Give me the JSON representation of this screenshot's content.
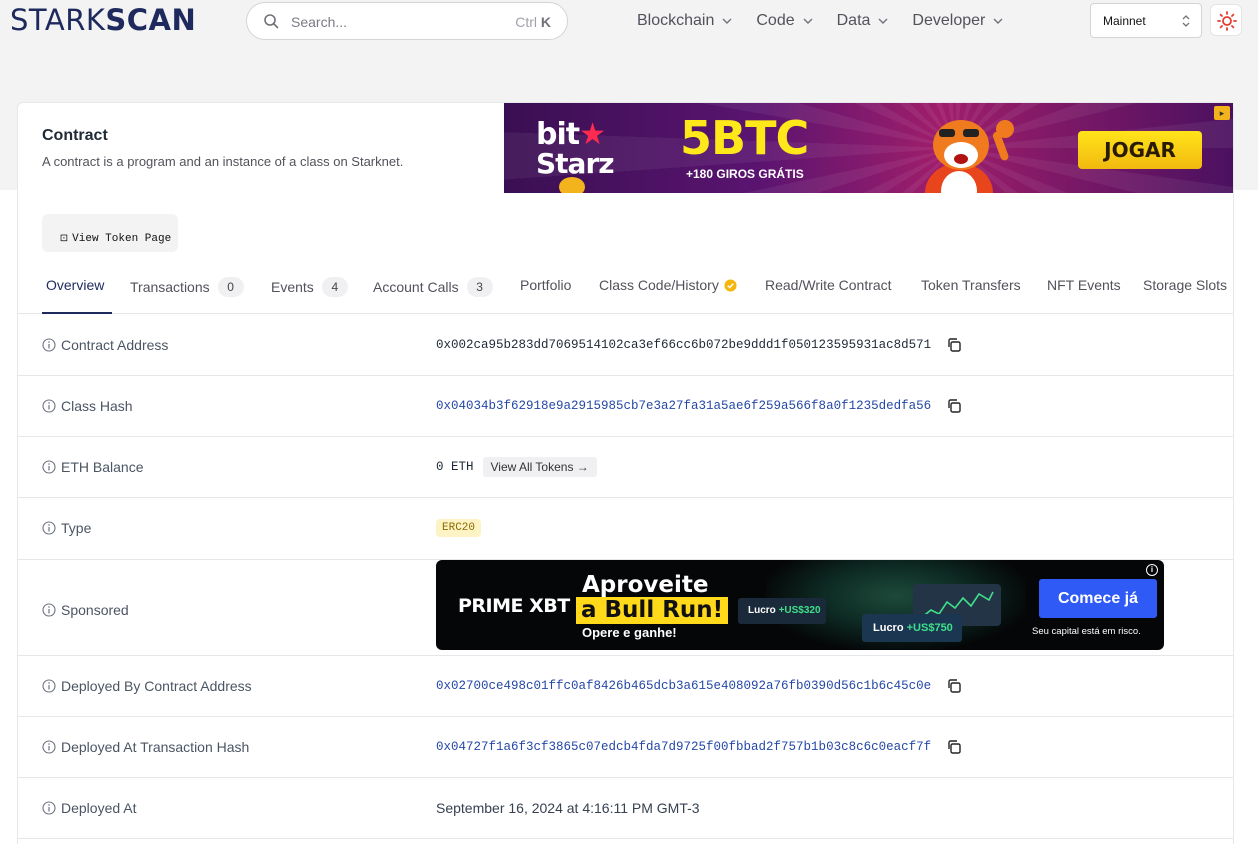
{
  "header": {
    "logo_light": "STARK",
    "logo_bold": "SCAN",
    "search_placeholder": "Search...",
    "search_shortcut_ctrl": "Ctrl",
    "search_shortcut_key": "K",
    "nav": [
      "Blockchain",
      "Code",
      "Data",
      "Developer"
    ],
    "network": "Mainnet"
  },
  "page": {
    "title": "Contract",
    "subtitle": "A contract is a program and an instance of a class on Starknet.",
    "token_button": "View Token Page"
  },
  "top_ad": {
    "brand_line1_a": "bit",
    "brand_line2": "Starz",
    "headline": "5BTC",
    "sub": "+180 GIROS GRÁTIS",
    "cta": "JOGAR"
  },
  "tabs": [
    {
      "label": "Overview",
      "count": null,
      "active": true
    },
    {
      "label": "Transactions",
      "count": "0"
    },
    {
      "label": "Events",
      "count": "4"
    },
    {
      "label": "Account Calls",
      "count": "3"
    },
    {
      "label": "Portfolio",
      "count": null
    },
    {
      "label": "Class Code/History",
      "count": null,
      "verified": true
    },
    {
      "label": "Read/Write Contract",
      "count": null
    },
    {
      "label": "Token Transfers",
      "count": null
    },
    {
      "label": "NFT Events",
      "count": null
    },
    {
      "label": "Storage Slots",
      "count": null
    }
  ],
  "details": {
    "contract_address": {
      "label": "Contract Address",
      "value": "0x002ca95b283dd7069514102ca3ef66cc6b072be9ddd1f050123595931ac8d571"
    },
    "class_hash": {
      "label": "Class Hash",
      "value": "0x04034b3f62918e9a2915985cb7e3a27fa31a5ae6f259a566f8a0f1235dedfa56"
    },
    "eth_balance": {
      "label": "ETH Balance",
      "value": "0 ETH",
      "action": "View All Tokens →"
    },
    "type": {
      "label": "Type",
      "value": "ERC20"
    },
    "sponsored": {
      "label": "Sponsored"
    },
    "deployed_by": {
      "label": "Deployed By Contract Address",
      "value": "0x02700ce498c01ffc0af8426b465dcb3a615e408092a76fb0390d56c1b6c45c0e"
    },
    "deployed_tx": {
      "label": "Deployed At Transaction Hash",
      "value": "0x04727f1a6f3cf3865c07edcb4fda7d9725f00fbbad2f757b1b03c8c6c0eacf7f"
    },
    "deployed_at": {
      "label": "Deployed At",
      "value": "September 16, 2024 at 4:16:11 PM GMT-3"
    }
  },
  "mid_ad": {
    "brand": "PRIME XBT",
    "line1": "Aproveite",
    "line2": "a Bull Run!",
    "line3": "Opere e ganhe!",
    "pill1_label": "Lucro",
    "pill1_value": "+US$320",
    "pill2_label": "Lucro",
    "pill2_value": "+US$750",
    "cta": "Comece já",
    "risk": "Seu capital está em risco."
  },
  "colors": {
    "brand": "#1e2a5e",
    "link": "#2447a8",
    "badge_bg": "#fdf3c4",
    "ad_cta_blue": "#2f5af5"
  }
}
